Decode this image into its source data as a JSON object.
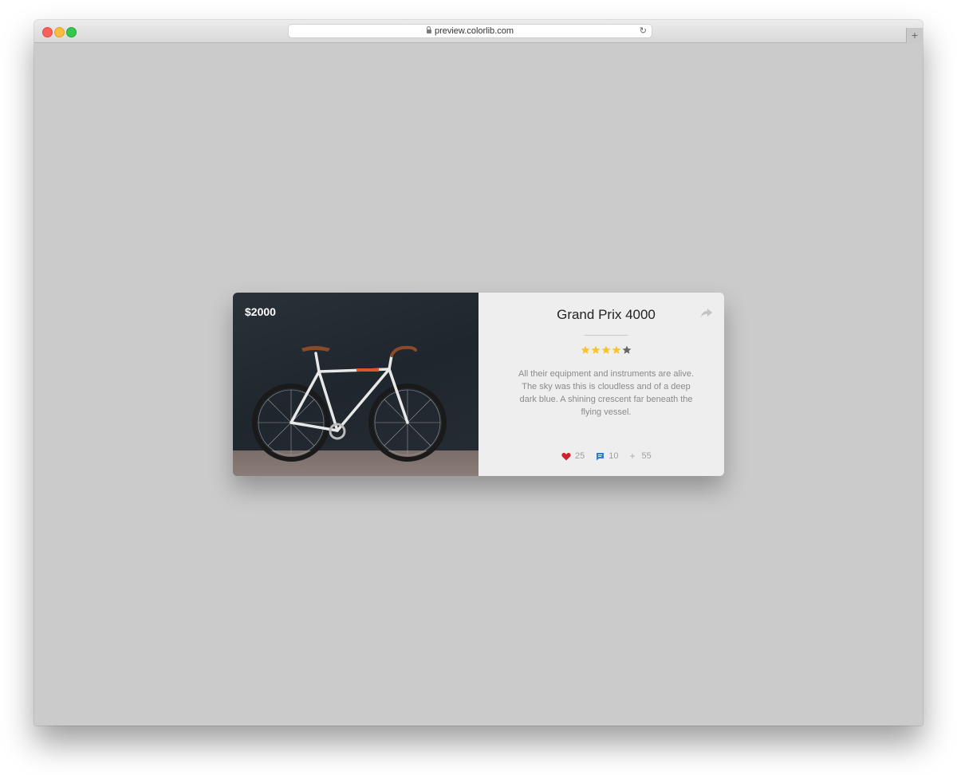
{
  "browser": {
    "url": "preview.colorlib.com",
    "new_tab_label": "+"
  },
  "card": {
    "price": "$2000",
    "title": "Grand Prix 4000",
    "rating": 4,
    "rating_max": 5,
    "description": "All their equipment and instruments are alive. The sky was this is cloudless and of a deep dark blue. A shining crescent far beneath the flying vessel.",
    "stats": {
      "likes": "25",
      "comments": "10",
      "shares": "55"
    },
    "colors": {
      "star_filled": "#f8c330",
      "star_empty": "#666666",
      "heart": "#d0202e",
      "comment": "#2f7bd6"
    }
  }
}
